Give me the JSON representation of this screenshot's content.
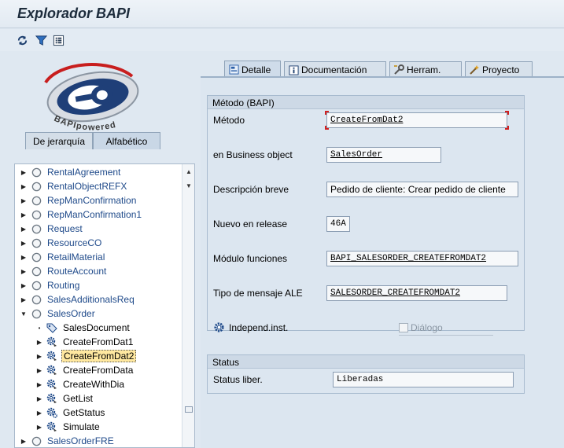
{
  "window": {
    "title": "Explorador BAPI"
  },
  "toolbar": {
    "buttons": [
      {
        "icon": "refresh-icon"
      },
      {
        "icon": "filter-icon"
      },
      {
        "icon": "list-icon"
      }
    ]
  },
  "logo": {
    "text": "BAPIpowered"
  },
  "left_tabs": [
    {
      "label": "De jerarquía",
      "active": false
    },
    {
      "label": "Alfabético",
      "active": true
    }
  ],
  "tree": {
    "items": [
      {
        "label": "RentalAgreement",
        "level": 0,
        "type": "object",
        "expanded": false
      },
      {
        "label": "RentalObjectREFX",
        "level": 0,
        "type": "object",
        "expanded": false
      },
      {
        "label": "RepManConfirmation",
        "level": 0,
        "type": "object",
        "expanded": false
      },
      {
        "label": "RepManConfirmation1",
        "level": 0,
        "type": "object",
        "expanded": false
      },
      {
        "label": "Request",
        "level": 0,
        "type": "object",
        "expanded": false
      },
      {
        "label": "ResourceCO",
        "level": 0,
        "type": "object",
        "expanded": false
      },
      {
        "label": "RetailMaterial",
        "level": 0,
        "type": "object",
        "expanded": false
      },
      {
        "label": "RouteAccount",
        "level": 0,
        "type": "object",
        "expanded": false
      },
      {
        "label": "Routing",
        "level": 0,
        "type": "object",
        "expanded": false
      },
      {
        "label": "SalesAdditionalsReq",
        "level": 0,
        "type": "object",
        "expanded": false
      },
      {
        "label": "SalesOrder",
        "level": 0,
        "type": "object",
        "expanded": true
      },
      {
        "label": "SalesDocument",
        "level": 1,
        "type": "tag",
        "expanded": false
      },
      {
        "label": "CreateFromDat1",
        "level": 1,
        "type": "method",
        "expanded": false
      },
      {
        "label": "CreateFromDat2",
        "level": 1,
        "type": "method",
        "expanded": false,
        "selected": true
      },
      {
        "label": "CreateFromData",
        "level": 1,
        "type": "method",
        "expanded": false
      },
      {
        "label": "CreateWithDia",
        "level": 1,
        "type": "method",
        "expanded": false
      },
      {
        "label": "GetList",
        "level": 1,
        "type": "method",
        "expanded": false
      },
      {
        "label": "GetStatus",
        "level": 1,
        "type": "method-gear",
        "expanded": false
      },
      {
        "label": "Simulate",
        "level": 1,
        "type": "method",
        "expanded": false
      },
      {
        "label": "SalesOrderFRE",
        "level": 0,
        "type": "object",
        "expanded": false
      }
    ]
  },
  "right_tabs": [
    {
      "label": "Detalle",
      "icon": "detail-icon",
      "active": true
    },
    {
      "label": "Documentación",
      "icon": "info-icon",
      "active": false
    },
    {
      "label": "Herram.",
      "icon": "tools-icon",
      "active": false
    },
    {
      "label": "Proyecto",
      "icon": "wand-icon",
      "active": false
    }
  ],
  "method_group": {
    "title": "Método (BAPI)",
    "fields": {
      "metodo": {
        "label": "Método",
        "value": "CreateFromDat2"
      },
      "business_object": {
        "label": "en Business object",
        "value": "SalesOrder"
      },
      "descripcion": {
        "label": "Descripción breve",
        "value": "Pedido de cliente: Crear pedido de cliente"
      },
      "release": {
        "label": "Nuevo en release",
        "value": "46A"
      },
      "modulo": {
        "label": "Módulo funciones",
        "value": "BAPI_SALESORDER_CREATEFROMDAT2"
      },
      "ale": {
        "label": "Tipo de mensaje ALE",
        "value": "SALESORDER_CREATEFROMDAT2"
      }
    },
    "independ": {
      "label": "Independ.inst."
    },
    "dialogo": {
      "label": "Diálogo",
      "checked": false,
      "disabled": true
    }
  },
  "status_group": {
    "title": "Status",
    "field": {
      "label": "Status liber.",
      "value": "Liberadas"
    }
  },
  "colors": {
    "accent": "#1f4a8a",
    "selected_bg": "#ffe8a0",
    "focus_corner": "#d02020"
  }
}
